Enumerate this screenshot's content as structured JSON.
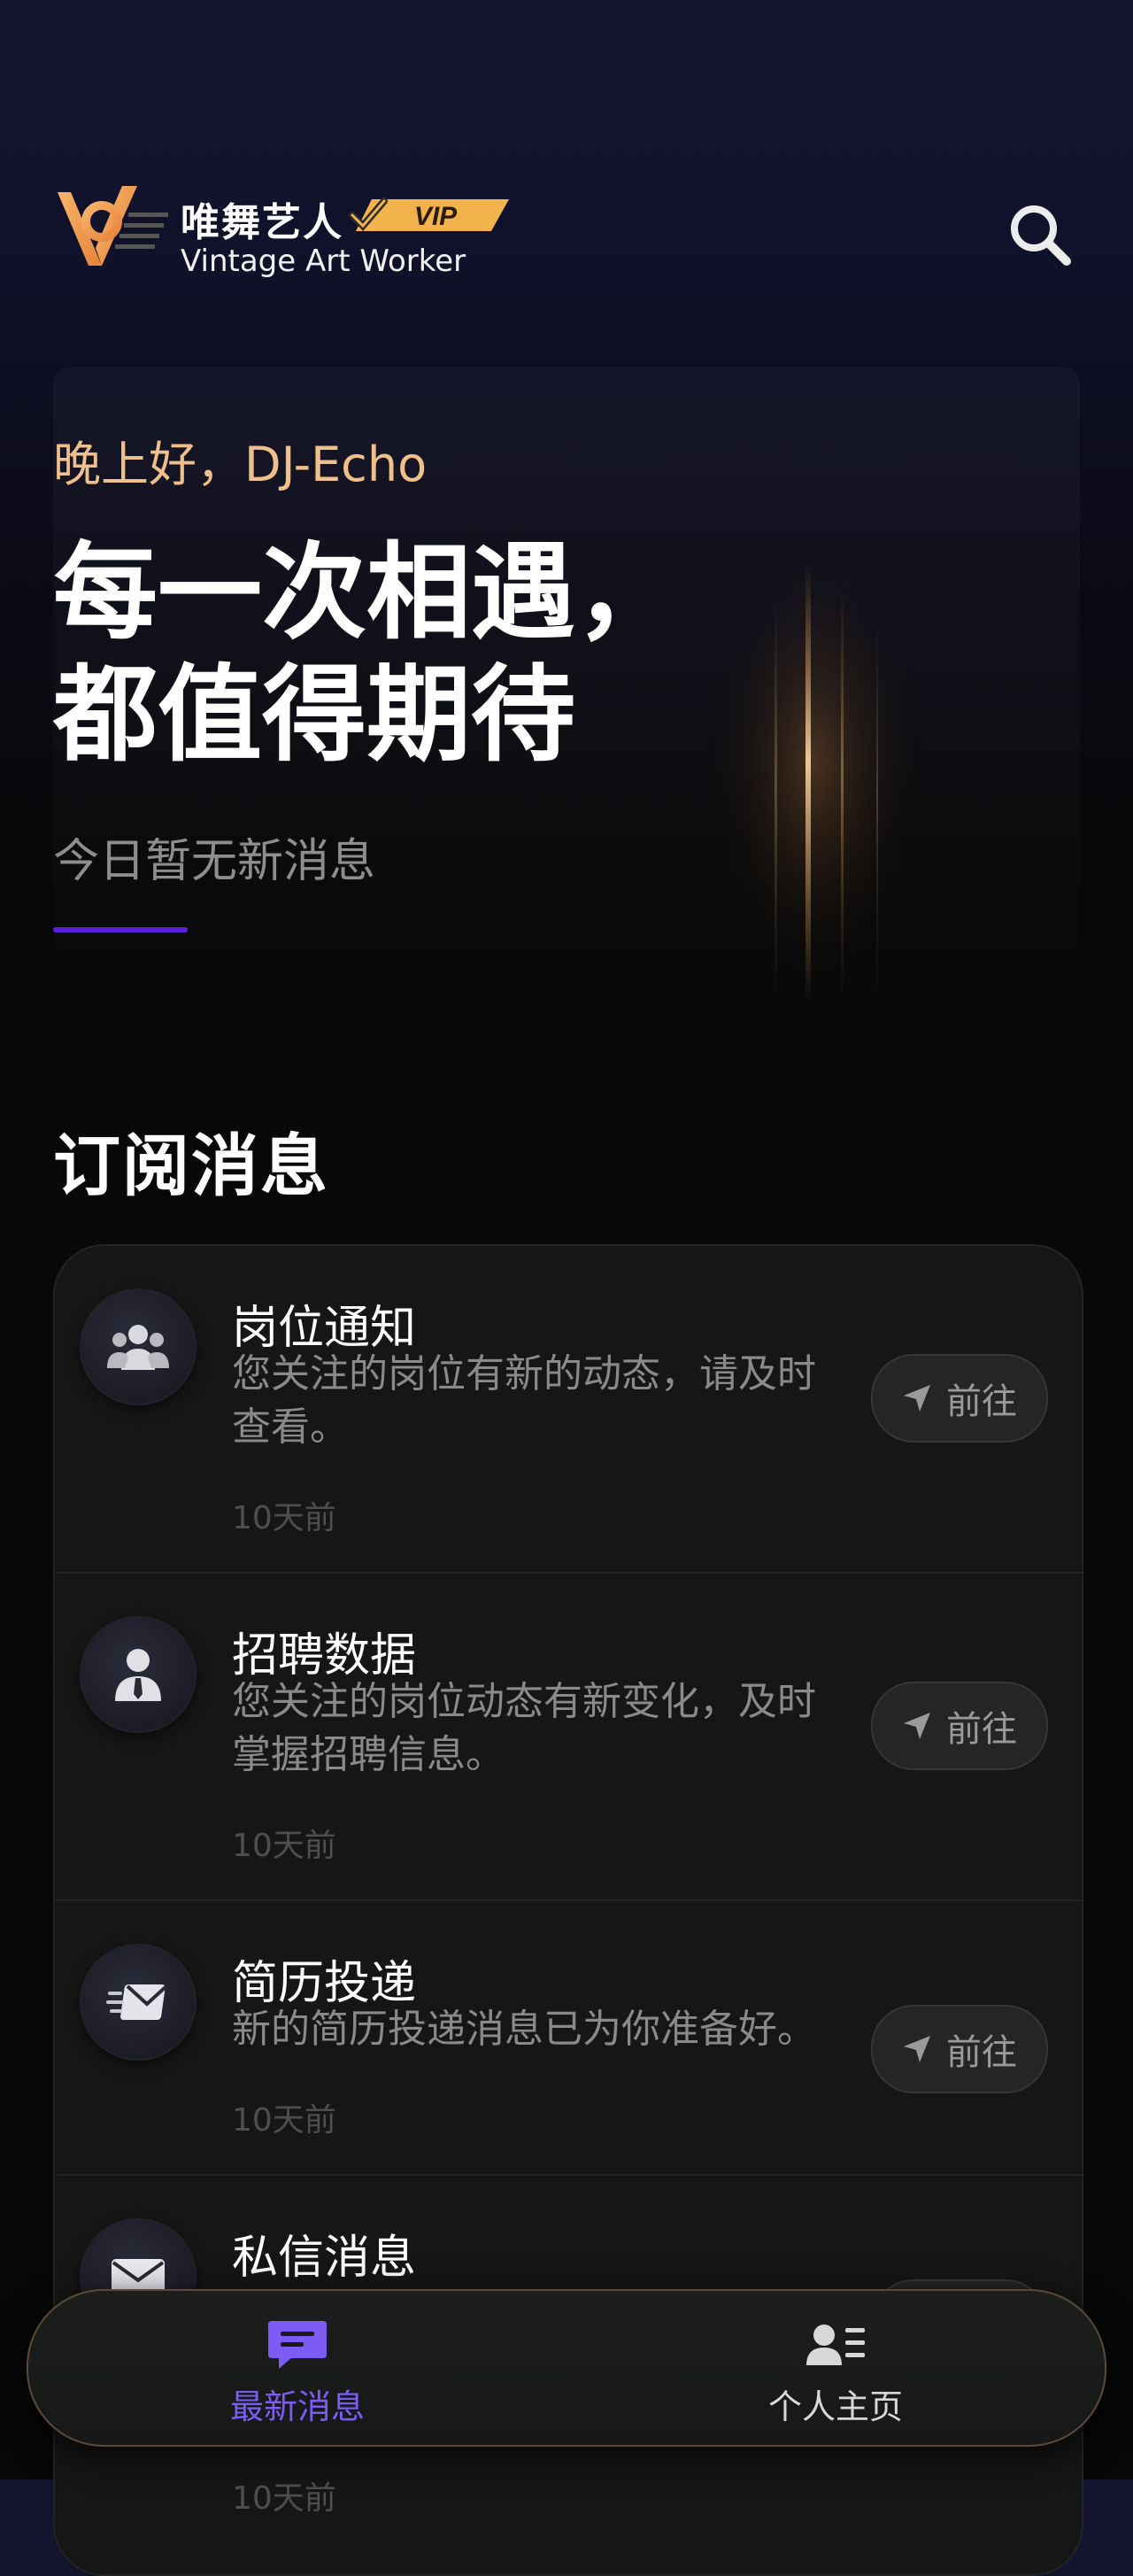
{
  "header": {
    "brand_name": "唯舞艺人",
    "brand_subtitle": "Vintage Art Worker",
    "vip_label": "VIP",
    "logo_icon": "vaw-logo-icon",
    "search_icon": "search-icon",
    "colors": {
      "logo_orange": "#f0a050",
      "vip_gold": "#f2b24c"
    }
  },
  "hero": {
    "greeting": "晚上好，DJ-Echo",
    "headline_line1": "每一次相遇，",
    "headline_line2": "都值得期待",
    "subline": "今日暂无新消息",
    "colors": {
      "greeting": "#f0c08a",
      "indicator": "#5b1fe0"
    }
  },
  "section": {
    "title": "订阅消息"
  },
  "subscriptions": [
    {
      "icon": "group-icon",
      "title": "岗位通知",
      "desc": "您关注的岗位有新的动态，请及时查看。",
      "time": "10天前",
      "button": "前往"
    },
    {
      "icon": "user-tie-icon",
      "title": "招聘数据",
      "desc": "您关注的岗位动态有新变化，及时掌握招聘信息。",
      "time": "10天前",
      "button": "前往"
    },
    {
      "icon": "send-mail-icon",
      "title": "简历投递",
      "desc": "新的简历投递消息已为你准备好。",
      "time": "10天前",
      "button": "前往"
    },
    {
      "icon": "envelope-icon",
      "title": "私信消息",
      "desc": "",
      "time": "10天前",
      "button": "前往"
    }
  ],
  "bottom_nav": {
    "items": [
      {
        "label": "最新消息",
        "icon": "chat-message-icon",
        "active": true
      },
      {
        "label": "个人主页",
        "icon": "profile-card-icon",
        "active": false
      }
    ],
    "active_color": "#7c5cf5"
  }
}
